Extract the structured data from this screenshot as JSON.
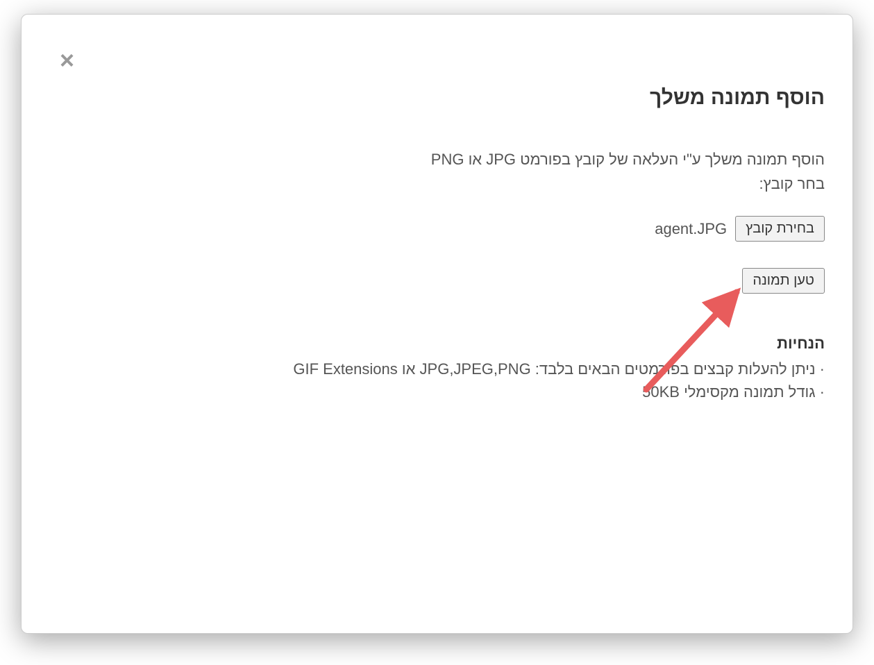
{
  "modal": {
    "title": "הוסף תמונה משלך",
    "instruction": "הוסף תמונה משלך ע\"י העלאה של קובץ בפורמט JPG או PNG",
    "choose_label": "בחר קובץ:",
    "choose_button": "בחירת קובץ",
    "file_name": "agent.JPG",
    "load_button": "טען תמונה",
    "guidelines_title": "הנחיות",
    "guideline_1": "ניתן להעלות קבצים בפורמטים הבאים בלבד: JPG,JPEG,PNG או GIF Extensions",
    "guideline_2": "גודל תמונה מקסימלי 50KB",
    "close_symbol": "×"
  }
}
